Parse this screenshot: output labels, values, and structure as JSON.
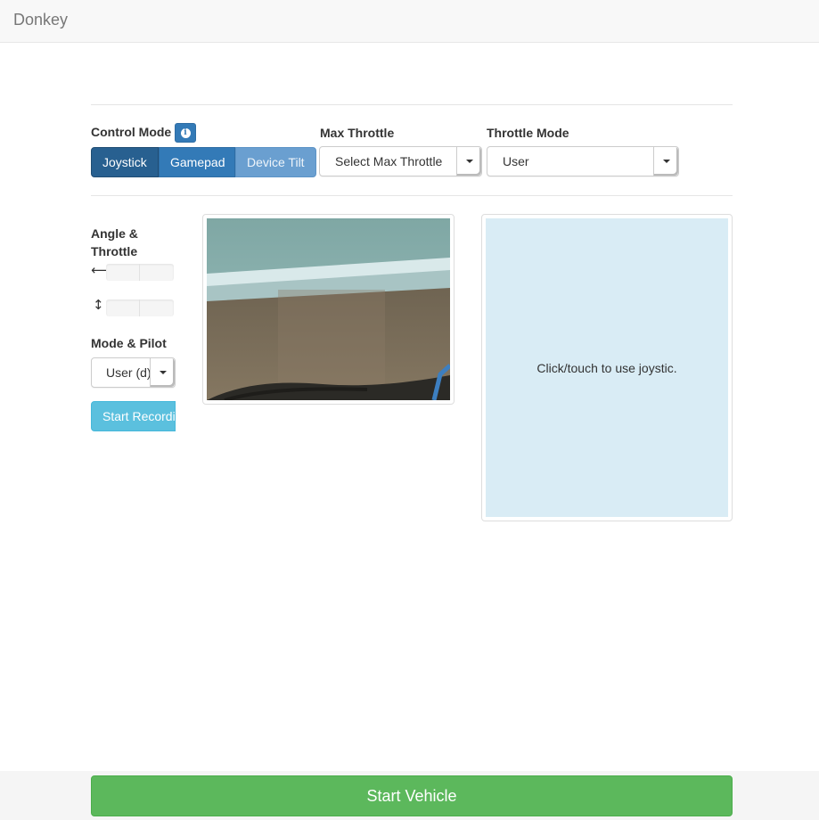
{
  "navbar": {
    "brand": "Donkey"
  },
  "control_mode": {
    "label": "Control Mode",
    "info_icon": "info-circle-icon",
    "options": [
      {
        "label": "Joystick",
        "state": "active"
      },
      {
        "label": "Gamepad",
        "state": "normal"
      },
      {
        "label": "Device Tilt",
        "state": "disabled"
      }
    ]
  },
  "max_throttle": {
    "label": "Max Throttle",
    "value": "Select Max Throttle"
  },
  "throttle_mode": {
    "label": "Throttle Mode",
    "value": "User"
  },
  "angle_throttle": {
    "label": "Angle & Throttle",
    "angle_icon": "left-right-arrow-icon",
    "throttle_icon": "up-down-arrow-icon",
    "angle_glyph": "⟷",
    "throttle_glyph": "↕"
  },
  "mode_pilot": {
    "label": "Mode & Pilot",
    "value": "User (d)"
  },
  "record_button": {
    "label": "Start Recording"
  },
  "joystick_panel": {
    "hint": "Click/touch to use joystic."
  },
  "start_vehicle": {
    "label": "Start Vehicle"
  },
  "colors": {
    "primary": "#337ab7",
    "primary_active": "#286090",
    "info": "#5bc0de",
    "success": "#5cb85c",
    "joystick_bg": "#d9ecf5"
  }
}
